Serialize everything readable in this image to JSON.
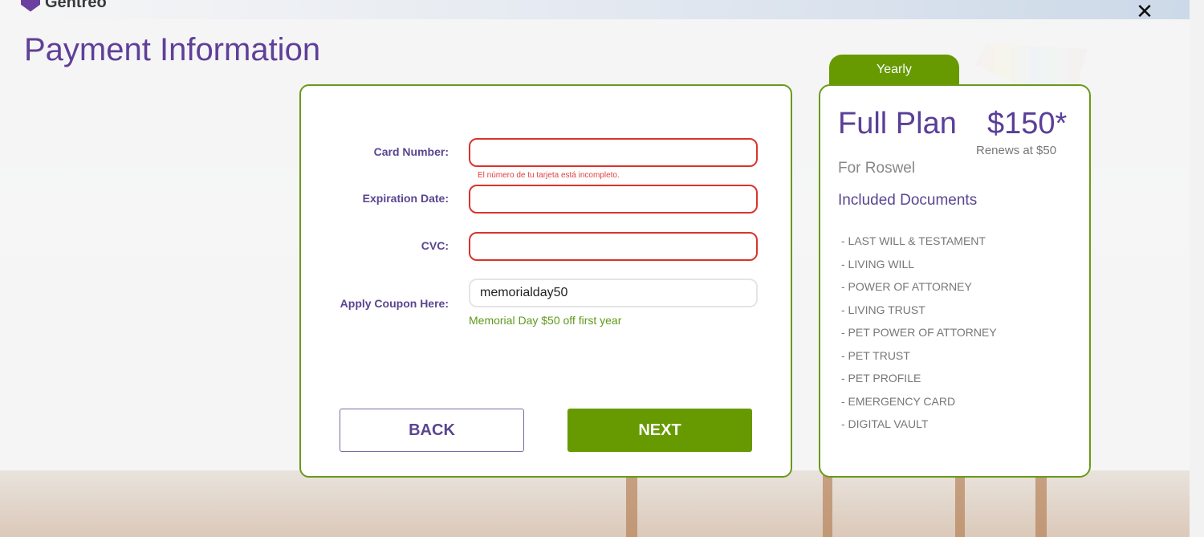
{
  "app": {
    "logo_text": "Gentreo",
    "close_icon": "close-icon"
  },
  "page": {
    "title": "Payment Information"
  },
  "form": {
    "card_number": {
      "label": "Card Number:",
      "value": "",
      "error": "El número de tu tarjeta está incompleto."
    },
    "expiration_date": {
      "label": "Expiration Date:",
      "value": ""
    },
    "cvc": {
      "label": "CVC:",
      "value": ""
    },
    "coupon": {
      "label": "Apply Coupon Here:",
      "value": "memorialday50",
      "message": "Memorial Day $50 off first year"
    },
    "back_label": "BACK",
    "next_label": "NEXT"
  },
  "plan": {
    "billing_tab": "Yearly",
    "name": "Full Plan",
    "price": "$150*",
    "renews": "Renews at $50",
    "for_label": "For Roswel",
    "included_heading": "Included Documents",
    "documents": [
      "- LAST WILL & TESTAMENT",
      "- LIVING WILL",
      "- POWER OF ATTORNEY",
      "- LIVING TRUST",
      "- PET POWER OF ATTORNEY",
      "- PET TRUST",
      "- PET PROFILE",
      "- EMERGENCY CARD",
      "- DIGITAL VAULT"
    ]
  },
  "colors": {
    "brand_purple": "#5f3f98",
    "brand_green": "#669a00",
    "error_red": "#d9342b"
  }
}
